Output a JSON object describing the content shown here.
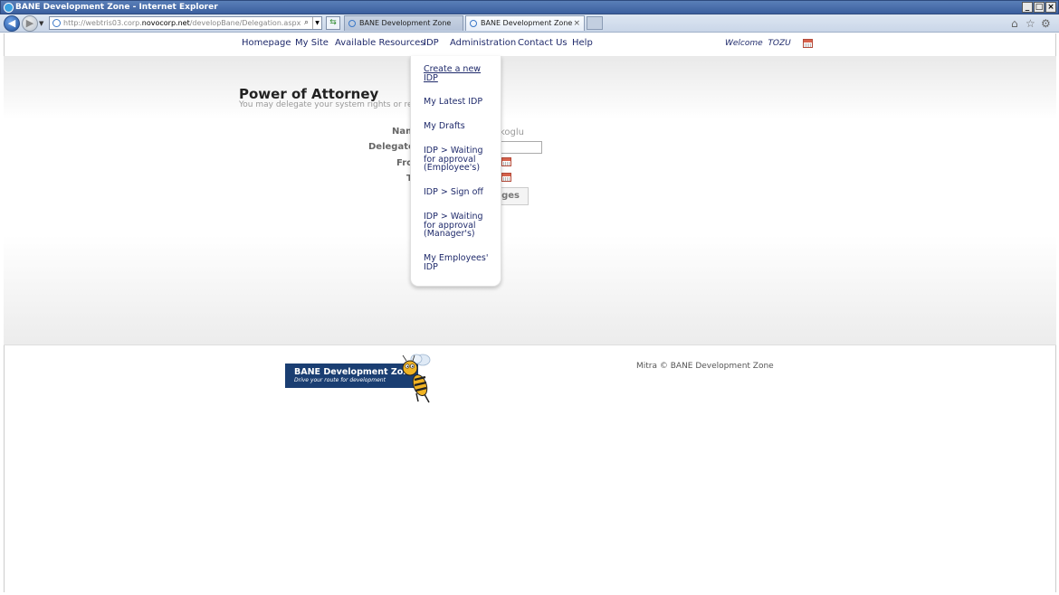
{
  "window": {
    "title": "BANE Development Zone - Internet Explorer"
  },
  "browser": {
    "address_prefix": "http://webtris03.corp.",
    "address_domain": "novocorp.net",
    "address_suffix": "/developBane/Delegation.aspx",
    "tabs": [
      {
        "label": "BANE Development Zone"
      },
      {
        "label": "BANE Development Zone"
      }
    ]
  },
  "nav": {
    "items": [
      "Homepage",
      "My Site",
      "Available Resources",
      "IDP",
      "Administration",
      "Contact Us",
      "Help"
    ],
    "welcome_label": "Welcome",
    "welcome_user": "TOZU"
  },
  "content": {
    "title": "Power of Attorney",
    "subtitle": "You may delegate your system rights or remove",
    "fields": {
      "name_label": "Nam",
      "name_value": "koglu",
      "delegate_label": "Delegate T",
      "from_label": "Fro",
      "to_label": "T"
    },
    "save_label": "nges"
  },
  "dropdown": {
    "items": [
      "Create a new IDP",
      "My Latest IDP",
      "My Drafts",
      "IDP > Waiting for approval (Employee's)",
      "IDP > Sign off",
      "IDP > Waiting for approval (Manager's)",
      "My Employees' IDP"
    ]
  },
  "footer": {
    "logo_title": "BANE Development Zone",
    "logo_tagline": "Drive your route for development",
    "copyright": "Mitra © BANE Development Zone"
  },
  "colors": {
    "nav_text": "#1f2a6b",
    "logo_bg": "#1a3e72"
  }
}
